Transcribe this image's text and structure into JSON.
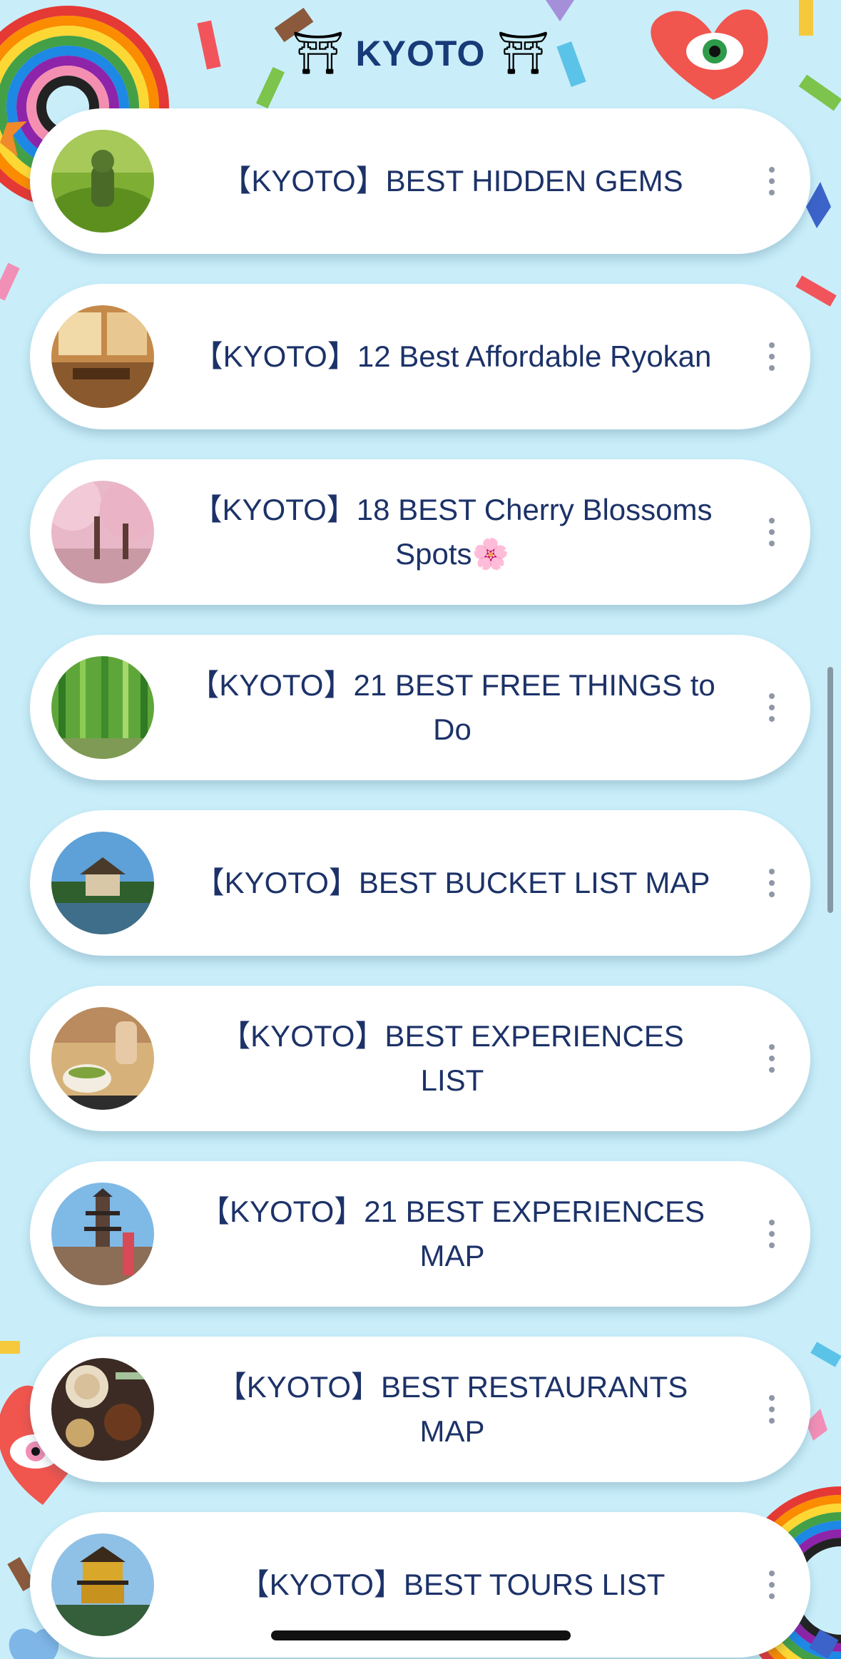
{
  "header": {
    "title": "KYOTO",
    "left_icon": "torii-gate-icon",
    "right_icon": "torii-gate-icon",
    "torii_glyph": "⛩"
  },
  "links": [
    {
      "label": "【KYOTO】BEST HIDDEN GEMS",
      "thumbnail": "moss-statue-thumbnail"
    },
    {
      "label": "【KYOTO】12 Best Affordable Ryokan",
      "thumbnail": "ryokan-room-thumbnail"
    },
    {
      "label": "【KYOTO】18 BEST Cherry Blossoms Spots🌸",
      "thumbnail": "cherry-blossom-thumbnail"
    },
    {
      "label": "【KYOTO】21 BEST FREE THINGS to Do",
      "thumbnail": "bamboo-forest-thumbnail"
    },
    {
      "label": "【KYOTO】BEST BUCKET LIST MAP",
      "thumbnail": "temple-pond-thumbnail"
    },
    {
      "label": "【KYOTO】BEST EXPERIENCES LIST",
      "thumbnail": "matcha-tea-thumbnail"
    },
    {
      "label": "【KYOTO】21 BEST EXPERIENCES MAP",
      "thumbnail": "pagoda-street-thumbnail"
    },
    {
      "label": "【KYOTO】BEST RESTAURANTS MAP",
      "thumbnail": "japanese-food-thumbnail"
    },
    {
      "label": "【KYOTO】BEST TOURS LIST",
      "thumbnail": "golden-pavilion-thumbnail"
    }
  ],
  "menu_icon": "more-vertical-icon",
  "colors": {
    "background": "#c9eefa",
    "card": "#ffffff",
    "text": "#1c3268",
    "title": "#173a78"
  }
}
